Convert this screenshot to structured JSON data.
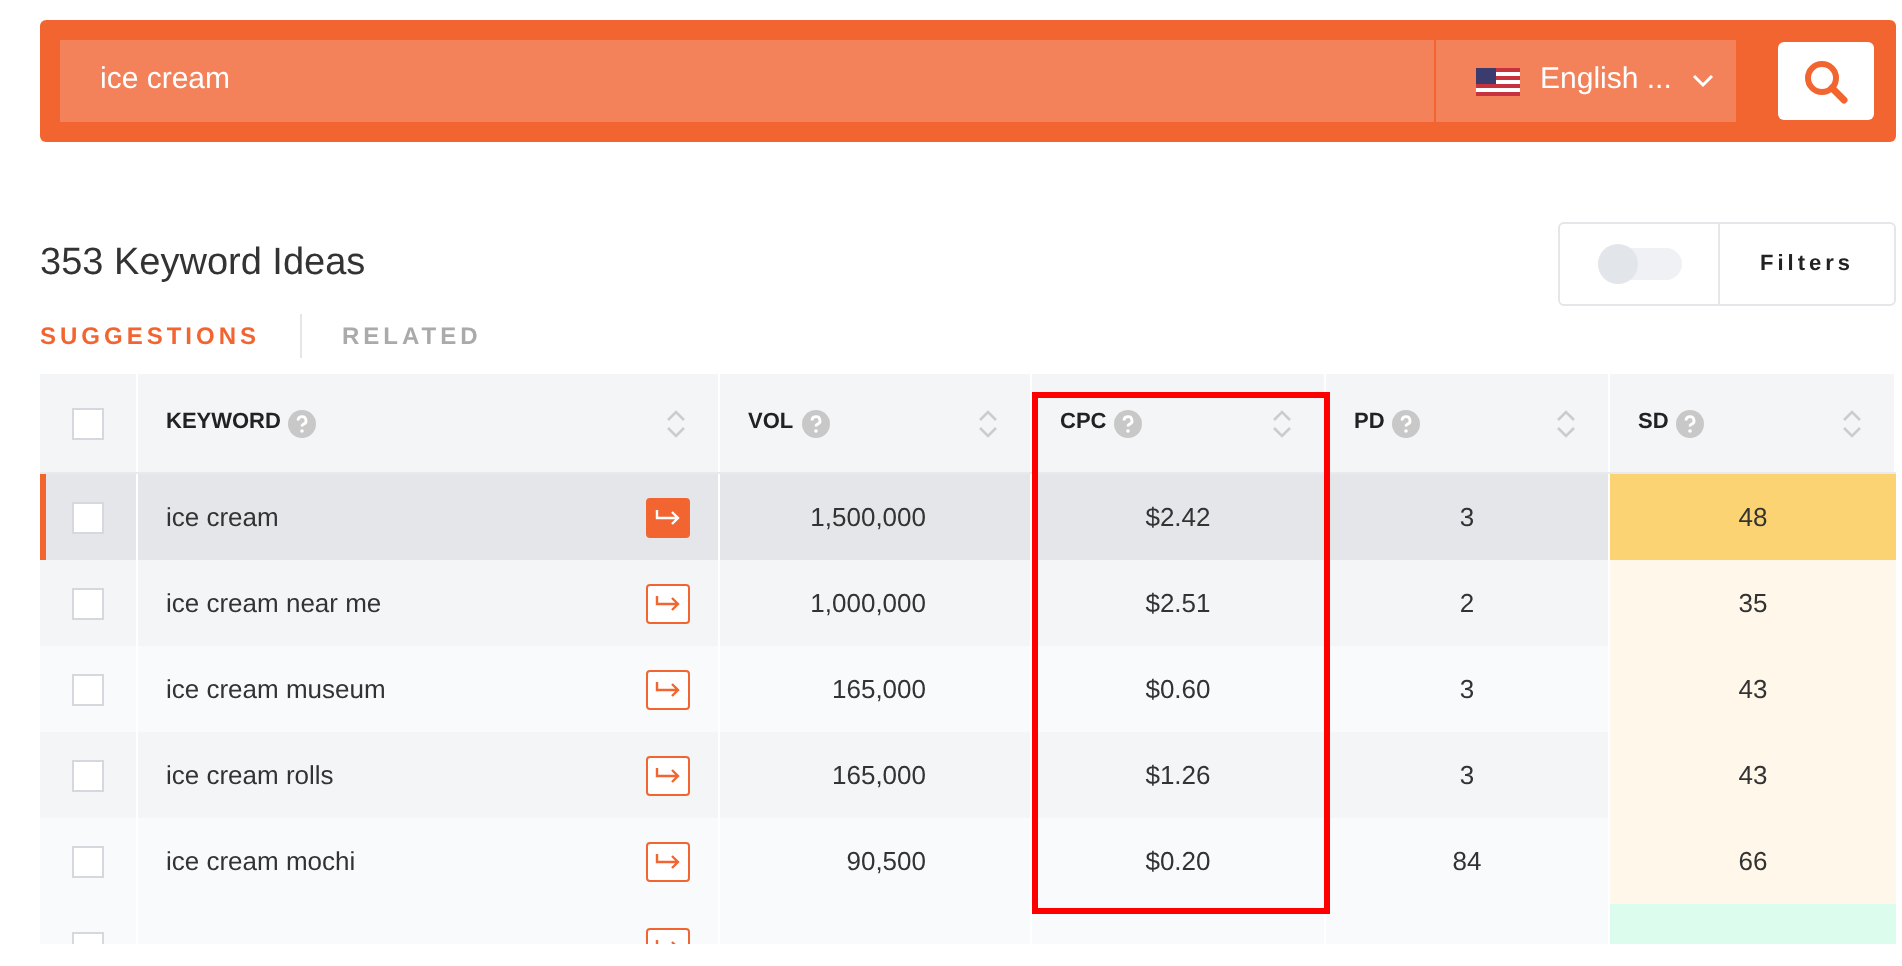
{
  "search": {
    "value": "ice cream",
    "language": "English ..."
  },
  "heading": "353 Keyword Ideas",
  "toggle": {
    "on": false
  },
  "filters_button": "Filters",
  "tabs": [
    {
      "label": "SUGGESTIONS",
      "selected": true
    },
    {
      "label": "RELATED",
      "selected": false
    }
  ],
  "table": {
    "select_all_checked": false,
    "columns": [
      {
        "label": "KEYWORD",
        "highlighted": false
      },
      {
        "label": "VOL",
        "highlighted": false
      },
      {
        "label": "CPC",
        "highlighted": true
      },
      {
        "label": "PD",
        "highlighted": false
      },
      {
        "label": "SD",
        "highlighted": false
      }
    ],
    "rows": [
      {
        "keyword": "ice cream",
        "vol": "1,500,000",
        "cpc": "$2.42",
        "pd": "3",
        "sd": "48",
        "color": "#fcd372",
        "selected": true,
        "checked": false
      },
      {
        "keyword": "ice cream near me",
        "vol": "1,000,000",
        "cpc": "$2.51",
        "pd": "2",
        "sd": "35",
        "color": "#fff8ea",
        "selected": false,
        "checked": false
      },
      {
        "keyword": "ice cream museum",
        "vol": "165,000",
        "cpc": "$0.60",
        "pd": "3",
        "sd": "43",
        "color": "#fff8ea",
        "selected": false,
        "checked": false
      },
      {
        "keyword": "ice cream rolls",
        "vol": "165,000",
        "cpc": "$1.26",
        "pd": "3",
        "sd": "43",
        "color": "#fff8ea",
        "selected": false,
        "checked": false
      },
      {
        "keyword": "ice cream mochi",
        "vol": "90,500",
        "cpc": "$0.20",
        "pd": "84",
        "sd": "66",
        "color": "#fff8ea",
        "selected": false,
        "checked": false
      }
    ],
    "partial_row": {
      "color": "#dcfcee",
      "checked": false
    }
  }
}
